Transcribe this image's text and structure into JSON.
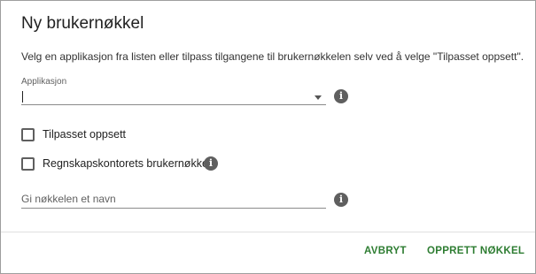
{
  "dialog": {
    "title": "Ny brukernøkkel",
    "description": "Velg en applikasjon fra listen eller tilpass tilgangene til brukernøkkelen selv ved å velge \"Tilpasset oppsett\".",
    "application_field": {
      "label": "Applikasjon",
      "value": ""
    },
    "checkboxes": [
      {
        "label": "Tilpasset oppsett",
        "checked": false
      },
      {
        "label": "Regnskapskontorets brukernøkkel",
        "checked": false
      }
    ],
    "name_field": {
      "placeholder": "Gi nøkkelen et navn",
      "value": ""
    },
    "buttons": {
      "cancel": "AVBRYT",
      "create": "OPPRETT NØKKEL"
    },
    "info_icon_glyph": "i",
    "accent_color": "#2e7d32"
  }
}
